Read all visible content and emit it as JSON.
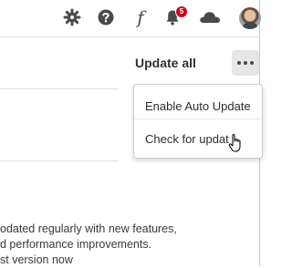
{
  "topbar": {
    "icons": [
      "gear-icon",
      "help-icon",
      "fonts-icon",
      "bell-icon",
      "cloud-icon",
      "avatar"
    ],
    "fonts_glyph": "f",
    "notification_count": "5"
  },
  "toolbar": {
    "update_all_label": "Update all",
    "more_icon": "ellipsis-icon"
  },
  "menu": {
    "items": [
      {
        "label": "Enable Auto Update"
      },
      {
        "label": "Check for updat"
      }
    ]
  },
  "body": {
    "lines": [
      "odated regularly with new features,",
      "d performance improvements.",
      "st version now"
    ]
  },
  "colors": {
    "badge": "#d0021b",
    "icon": "#4a4a4a",
    "button_bg": "#e6e6e6"
  }
}
